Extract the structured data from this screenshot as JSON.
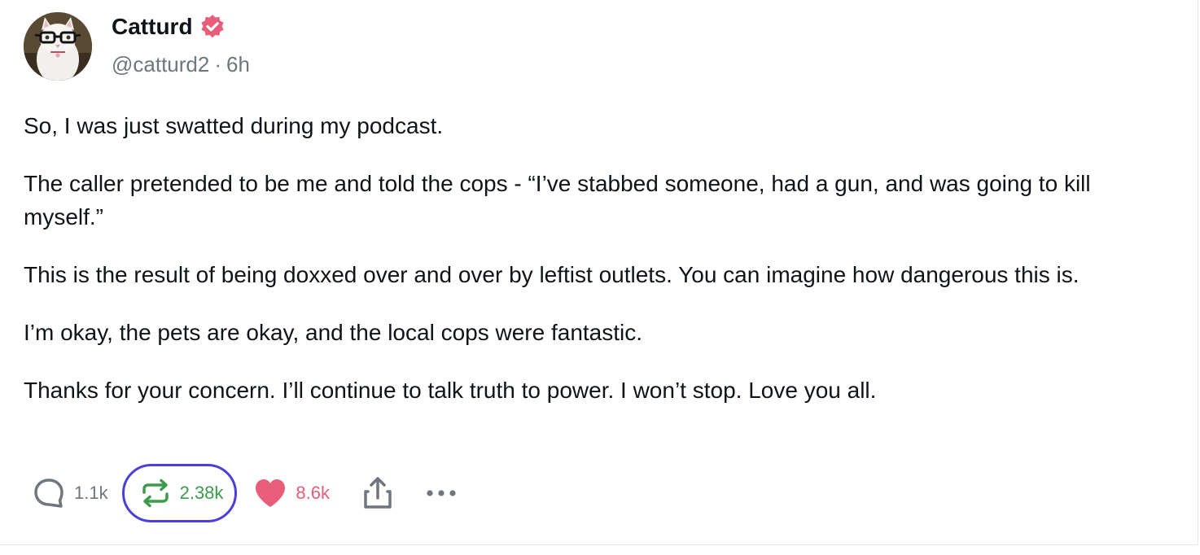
{
  "author": {
    "display_name": "Catturd",
    "handle": "@catturd2",
    "separator": "·",
    "time": "6h",
    "verified": true,
    "verified_color": "#e75d7a"
  },
  "post": {
    "paragraphs": [
      "So, I was just swatted during my podcast.",
      "The caller pretended to be me and told the cops - “I’ve stabbed someone, had a gun, and was going to kill myself.”",
      "This is the result of being doxxed over and over by leftist outlets. You can imagine how dangerous this is.",
      "I’m okay, the pets are okay, and the local cops were fantastic.",
      "Thanks for your concern. I’ll continue to talk truth to power. I won’t stop.  Love you all."
    ]
  },
  "actions": {
    "reply": {
      "icon": "reply-icon",
      "count": "1.1k",
      "color": "#6f767d"
    },
    "repost": {
      "icon": "repost-icon",
      "count": "2.38k",
      "color": "#3c9b4a",
      "highlight_color": "#4a3fd8"
    },
    "like": {
      "icon": "heart-icon",
      "count": "8.6k",
      "color": "#e75d7a"
    },
    "share": {
      "icon": "share-icon"
    },
    "more": {
      "icon": "more-icon"
    }
  }
}
